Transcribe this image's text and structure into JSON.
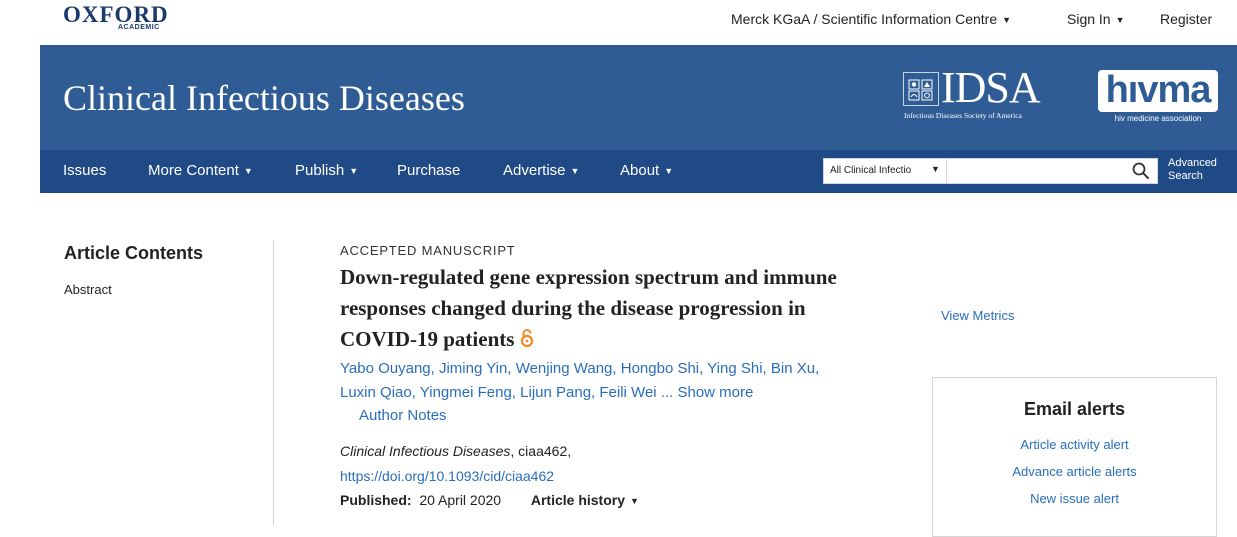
{
  "header": {
    "publisher": "OXFORD",
    "publisher_sub": "ACADEMIC",
    "institution": "Merck KGaA / Scientific Information Centre",
    "sign_in": "Sign In",
    "register": "Register"
  },
  "banner": {
    "journal_title": "Clinical Infectious Diseases",
    "idsa_logo": "IDSA",
    "idsa_sub": "Infectious Diseases Society of America",
    "hivma_logo": "hıvma",
    "hivma_sub": "hiv medicine association"
  },
  "nav": {
    "items": [
      "Issues",
      "More Content",
      "Publish",
      "Purchase",
      "Advertise",
      "About"
    ],
    "dropdown_caret": "▼",
    "search_scope": "All Clinical Infectio",
    "search_placeholder": "",
    "advanced_search": [
      "Advanced",
      "Search"
    ]
  },
  "sidebar": {
    "title": "Article Contents",
    "items": [
      "Abstract"
    ]
  },
  "article": {
    "label": "ACCEPTED MANUSCRIPT",
    "title": "Down-regulated gene expression spectrum and immune responses changed during the disease progression in COVID-19 patients",
    "authors": [
      "Yabo Ouyang",
      "Jiming Yin",
      "Wenjing Wang",
      "Hongbo Shi",
      "Ying Shi",
      "Bin Xu",
      "Luxin Qiao",
      "Yingmei Feng",
      "Lijun Pang",
      "Feili Wei"
    ],
    "authors_more": "... Show more",
    "author_notes": "Author Notes",
    "journal": "Clinical Infectious Diseases",
    "article_id": ", ciaa462,",
    "doi": "https://doi.org/10.1093/cid/ciaa462",
    "published_label": "Published:",
    "published_date": "20 April 2020",
    "history_label": "Article history"
  },
  "right_panel": {
    "view_metrics": "View Metrics",
    "alerts_title": "Email alerts",
    "alerts": [
      "Article activity alert",
      "Advance article alerts",
      "New issue alert"
    ]
  },
  "colors": {
    "banner": "#2f5c95",
    "nav": "#1f4a85",
    "link": "#2a6ebb",
    "open_access": "#f08a24"
  },
  "icons": {
    "search": "magnifier",
    "open_access": "open-lock",
    "caret": "triangle-down"
  }
}
